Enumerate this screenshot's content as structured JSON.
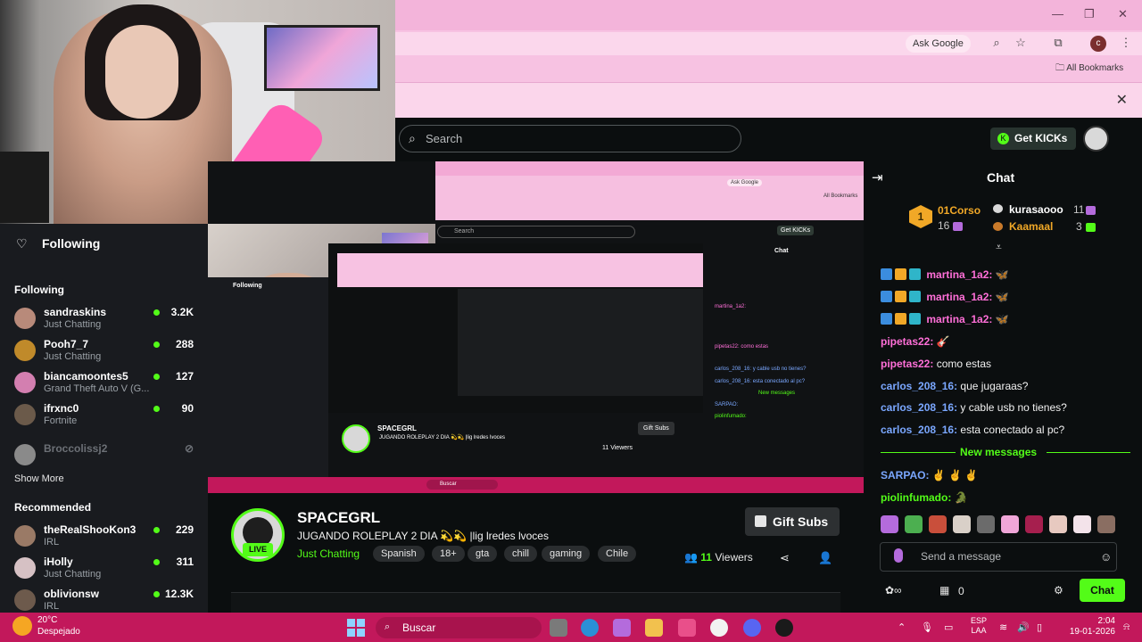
{
  "browser": {
    "ask_google": "Ask Google",
    "avatar_letter": "c",
    "all_bookmarks": "All Bookmarks",
    "min": "—",
    "max": "❐",
    "close": "✕"
  },
  "kick": {
    "search_placeholder": "Search",
    "get_kicks": "Get KICKs",
    "sidebar": {
      "following_header": "Following",
      "following_label": "Following",
      "show_more": "Show More",
      "recommended_label": "Recommended",
      "following": [
        {
          "name": "sandraskins",
          "game": "Just Chatting",
          "viewers": "3.2K",
          "avatar_color": "#b88a7a"
        },
        {
          "name": "Pooh7_7",
          "game": "Just Chatting",
          "viewers": "288",
          "avatar_color": "#c08a2a"
        },
        {
          "name": "biancamoontes5",
          "game": "Grand Theft Auto V (G...",
          "viewers": "127",
          "avatar_color": "#d37fb0"
        },
        {
          "name": "ifrxnc0",
          "game": "Fortnite",
          "viewers": "90",
          "avatar_color": "#6b5a4a"
        },
        {
          "name": "Broccolissj2",
          "game": "",
          "viewers": "",
          "avatar_color": "#8a8a8a"
        }
      ],
      "recommended": [
        {
          "name": "theRealShooKon3",
          "game": "IRL",
          "viewers": "229",
          "avatar_color": "#9a7a66"
        },
        {
          "name": "iHolly",
          "game": "Just Chatting",
          "viewers": "311",
          "avatar_color": "#d6c1c4"
        },
        {
          "name": "oblivionsw",
          "game": "IRL",
          "viewers": "12.3K",
          "avatar_color": "#6d5a4c"
        }
      ]
    },
    "channel": {
      "name": "SPACEGRL",
      "title": "JUGANDO ROLEPLAY 2 DIA  💫💫 |lig lredes lvoces",
      "category": "Just Chatting",
      "live": "LIVE",
      "tags": [
        "Spanish",
        "18+",
        "gta",
        "chill",
        "gaming",
        "Chile"
      ],
      "gift_subs": "Gift Subs",
      "viewers_count": "11",
      "viewers_label": "Viewers"
    },
    "chat": {
      "title": "Chat",
      "pinned": [
        {
          "rank": "1",
          "name": "01Corso",
          "count": "16",
          "color": "#f1a827"
        },
        {
          "name": "kurasaooo",
          "count": "11",
          "color": "#ffffff"
        },
        {
          "name": "Kaamaal",
          "count": "3",
          "color": "#f1a827"
        }
      ],
      "messages": [
        {
          "user": "martina_1a2:",
          "text": " 🦋",
          "color": "#ff6fd8",
          "badges": true
        },
        {
          "user": "martina_1a2:",
          "text": " 🦋",
          "color": "#ff6fd8",
          "badges": true
        },
        {
          "user": "martina_1a2:",
          "text": " 🦋",
          "color": "#ff6fd8",
          "badges": true
        },
        {
          "user": "pipetas22:",
          "text": " 🎸",
          "color": "#ff6fd8",
          "badges": false
        },
        {
          "user": "pipetas22:",
          "text": " como estas",
          "color": "#ff6fd8",
          "badges": false
        },
        {
          "user": "carlos_208_16:",
          "text": " que jugaraas?",
          "color": "#7aa7ff",
          "badges": false
        },
        {
          "user": "carlos_208_16:",
          "text": " y cable usb no tienes?",
          "color": "#7aa7ff",
          "badges": false
        },
        {
          "user": "carlos_208_16:",
          "text": " esta conectado al pc?",
          "color": "#7aa7ff",
          "badges": false
        }
      ],
      "new_messages": "New messages",
      "after": [
        {
          "user": "SARPAO:",
          "text": " ✌ ✌ ✌",
          "color": "#7aa7ff"
        },
        {
          "user": "piolinfumado:",
          "text": " 🐊",
          "color": "#53fc18"
        }
      ],
      "input_placeholder": "Send a message",
      "points": "0",
      "send": "Chat"
    }
  },
  "stream_mirror": {
    "search": "Search",
    "get_kicks": "Get KICKs",
    "ask_google": "Ask Google",
    "all_bookmarks": "All Bookmarks",
    "following": "Following",
    "chat": "Chat",
    "channel_name": "SPACEGRL",
    "channel_title": "JUGANDO ROLEPLAY 2 DIA  💫💫 |lig lredes lvoces",
    "gift_subs": "Gift Subs",
    "viewers": "11 Viewers",
    "taskbar_search": "Buscar",
    "chat_lines": [
      {
        "t": "martina_1a2:",
        "c": "#ff6fd8"
      },
      {
        "t": "pipetas22: como estas",
        "c": "#ff6fd8"
      },
      {
        "t": "carlos_208_16: y cable usb no tienes?",
        "c": "#7aa7ff"
      },
      {
        "t": "carlos_208_16: esta conectado al pc?",
        "c": "#7aa7ff"
      },
      {
        "t": "New messages",
        "c": "#53fc18"
      },
      {
        "t": "SARPAO:",
        "c": "#7aa7ff"
      },
      {
        "t": "piolinfumado:",
        "c": "#53fc18"
      }
    ]
  },
  "taskbar": {
    "temp": "20°C",
    "weather": "Despejado",
    "search": "Buscar",
    "lang1": "ESP",
    "lang2": "LAA",
    "time": "2:04",
    "date": "19-01-2026"
  },
  "colors": {
    "kick_green": "#53fc18",
    "taskbar": "#c2185b",
    "chrome_pink": "#f7c2e2"
  }
}
